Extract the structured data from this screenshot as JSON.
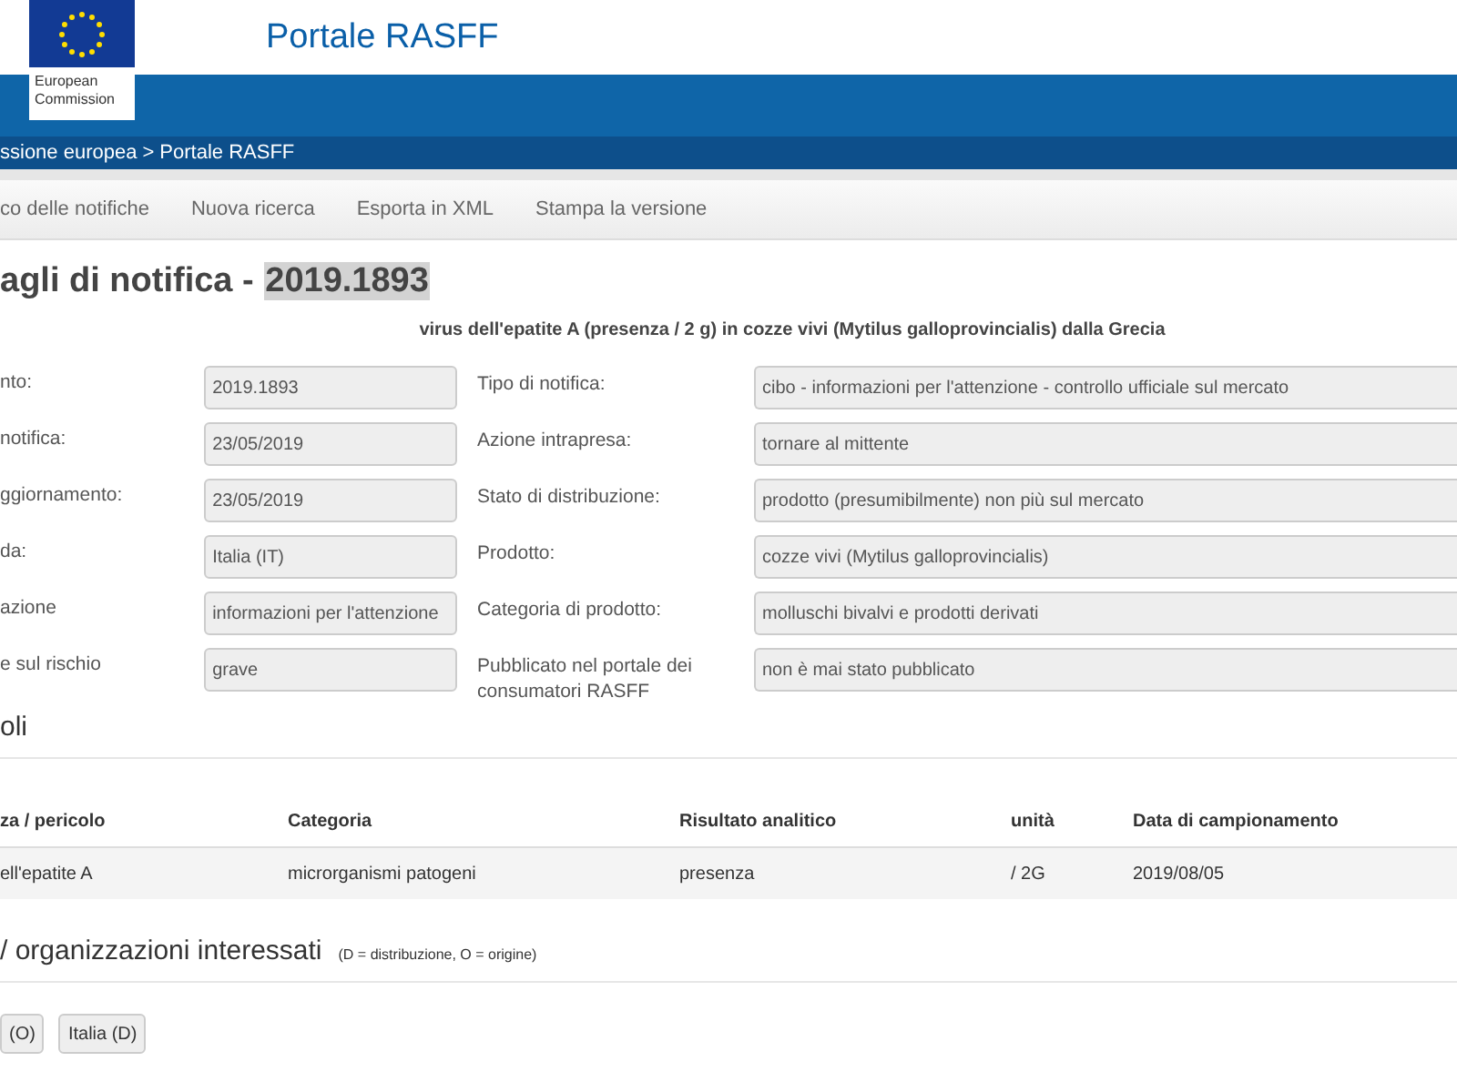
{
  "header": {
    "logo_text": "European Commission",
    "site_title": "Portale RASFF"
  },
  "breadcrumb": [
    {
      "label": "ssione europea",
      "separator": ">"
    },
    {
      "label": "Portale RASFF"
    }
  ],
  "nav": [
    {
      "label": "co delle notifiche"
    },
    {
      "label": "Nuova ricerca"
    },
    {
      "label": "Esporta in XML"
    },
    {
      "label": "Stampa la versione"
    }
  ],
  "title": {
    "prefix": "agli di notifica - ",
    "reference": "2019.1893"
  },
  "subject": "virus dell'epatite A (presenza / 2 g) in cozze vivi (Mytilus galloprovincialis) dalla Grecia",
  "details": [
    {
      "left_label": "nto:",
      "left_value": "2019.1893",
      "right_label": "Tipo di notifica:",
      "right_value": "cibo - informazioni per l'attenzione - controllo ufficiale sul mercato"
    },
    {
      "left_label": "notifica:",
      "left_value": "23/05/2019",
      "right_label": "Azione intrapresa:",
      "right_value": "tornare al mittente"
    },
    {
      "left_label": "ggiornamento:",
      "left_value": "23/05/2019",
      "right_label": "Stato di distribuzione:",
      "right_value": "prodotto (presumibilmente) non più sul mercato"
    },
    {
      "left_label": "da:",
      "left_value": "Italia (IT)",
      "right_label": "Prodotto:",
      "right_value": "cozze vivi (Mytilus galloprovincialis)"
    },
    {
      "left_label": "azione",
      "left_value": "informazioni per l'attenzione",
      "right_label": "Categoria di prodotto:",
      "right_value": "molluschi bivalvi e prodotti derivati"
    },
    {
      "left_label": "e sul rischio",
      "left_value": "grave",
      "right_label": "Pubblicato nel portale dei consumatori RASFF",
      "right_value": "non è mai stato pubblicato"
    }
  ],
  "hazards": {
    "heading": "oli",
    "table": {
      "columns": [
        "za / pericolo",
        "Categoria",
        "Risultato analitico",
        "unità",
        "Data di campionamento"
      ],
      "rows": [
        [
          "ell'epatite A",
          "microrganismi patogeni",
          "presenza",
          "/ 2G",
          "2019/08/05"
        ]
      ]
    }
  },
  "countries": {
    "heading": "/ organizzazioni interessati",
    "note": "(D = distribuzione, O = origine)",
    "buttons": [
      {
        "label": "(O)"
      },
      {
        "label": "Italia (D)"
      }
    ]
  }
}
